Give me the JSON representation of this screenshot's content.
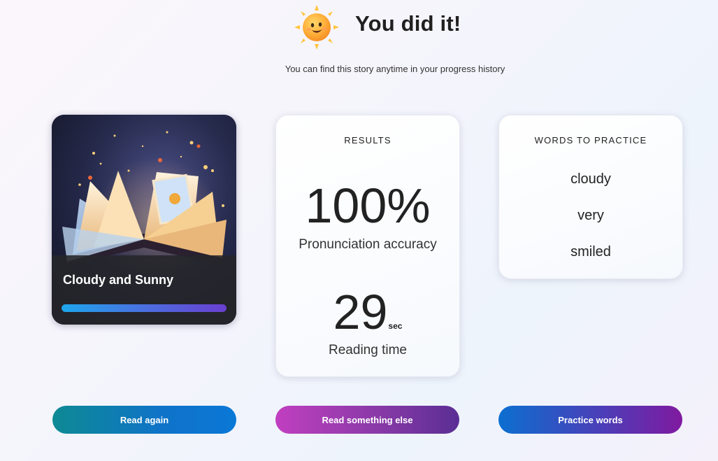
{
  "header": {
    "title": "You did it!",
    "subtitle": "You can find this story anytime in your progress history",
    "icon": "smiling-sun-icon"
  },
  "story": {
    "title": "Cloudy and Sunny",
    "progress": 1.0,
    "image": "open-book-illustration"
  },
  "results": {
    "heading": "RESULTS",
    "accuracy_value": "100%",
    "accuracy_label": "Pronunciation accuracy",
    "time_value": "29",
    "time_unit": "sec",
    "time_label": "Reading time"
  },
  "practice": {
    "heading": "WORDS TO PRACTICE",
    "words": [
      "cloudy",
      "very",
      "smiled"
    ]
  },
  "buttons": {
    "read_again": "Read again",
    "read_else": "Read something else",
    "practice": "Practice words"
  },
  "colors": {
    "progress_start": "#1ea6ec",
    "progress_end": "#6a3fd0",
    "read_again_start": "#0e8a94",
    "read_again_end": "#0a78d6",
    "read_else_start": "#c03fc0",
    "read_else_end": "#5a2e94",
    "practice_start": "#0c6fd0",
    "practice_end": "#801aa0"
  }
}
